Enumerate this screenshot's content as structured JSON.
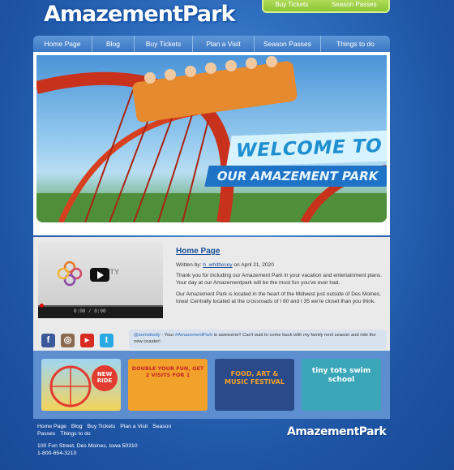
{
  "brand": {
    "logo_text": "AmazementPark",
    "footer_logo_text": "AmazementPark"
  },
  "topbar": {
    "items": [
      "Buy Tickets",
      "Season Passes"
    ]
  },
  "nav": {
    "items": [
      "Home Page",
      "Blog",
      "Buy Tickets",
      "Plan a Visit",
      "Season Passes",
      "Things to do"
    ]
  },
  "hero": {
    "line1": "WELCOME TO",
    "line2": "OUR AMAZEMENT PARK"
  },
  "video": {
    "brand_text": "VITY",
    "time": "0:00 / 0:00"
  },
  "post": {
    "title": "Home Page",
    "written_by": "Written by:",
    "author": "h_whittlesey",
    "date_text": "on April 21, 2020",
    "paragraph1": "Thank you for including our Amazement Park in your vacation and entertainment plans. Your day at our Amazementpark will be the most fun you've ever had.",
    "paragraph2": "Our Amazement Park is located in the heart of the Midwest just outside of Des Moines, Iowa!  Centrally located at the crossroads of I  80 and I  35 we're closet than you think."
  },
  "social": {
    "icons": [
      "facebook-icon",
      "instagram-icon",
      "youtube-icon",
      "twitter-icon"
    ],
    "tweet_handle": "@somebody",
    "tweet_mid": " - Your ",
    "tweet_tag": "#AmazementPark",
    "tweet_rest": " is awesome!! Can't wait to come back with my family next season and ride the new coaster!"
  },
  "promos": [
    {
      "label": "NEW RIDE"
    },
    {
      "label": "DOUBLE YOUR FUN, GET 2 VISITS FOR 1"
    },
    {
      "label": "FOOD, ART & MUSIC FESTIVAL"
    },
    {
      "label": "tiny tots swim school"
    }
  ],
  "footer": {
    "links": [
      "Home Page",
      "Blog",
      "Buy Tickets",
      "Plan a Visit",
      "Season Passes",
      "Things to do"
    ],
    "address": "100 Fun Street, Des Moines, Iowa 50310",
    "phone": "1-800-654-3210"
  }
}
